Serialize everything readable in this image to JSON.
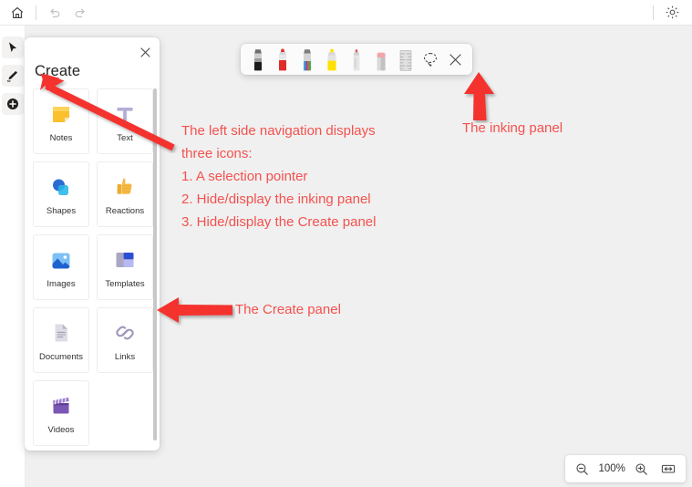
{
  "topbar": {
    "home_icon": "home-icon",
    "undo_icon": "undo-icon",
    "redo_icon": "redo-icon",
    "settings_icon": "gear-icon"
  },
  "leftnav": {
    "items": [
      {
        "name": "selection-pointer",
        "icon": "cursor-arrow-icon",
        "label": "Selection pointer"
      },
      {
        "name": "inking",
        "icon": "pen-icon",
        "label": "Hide/display the inking panel"
      },
      {
        "name": "create",
        "icon": "plus-circle-icon",
        "label": "Hide/display the Create panel"
      }
    ]
  },
  "create_panel": {
    "title": "Create",
    "close_icon": "close-icon",
    "tiles": [
      {
        "label": "Notes",
        "icon": "sticky-note-icon"
      },
      {
        "label": "Text",
        "icon": "text-t-icon"
      },
      {
        "label": "Shapes",
        "icon": "shapes-icon"
      },
      {
        "label": "Reactions",
        "icon": "thumbs-up-icon"
      },
      {
        "label": "Images",
        "icon": "image-icon"
      },
      {
        "label": "Templates",
        "icon": "templates-icon"
      },
      {
        "label": "Documents",
        "icon": "document-icon"
      },
      {
        "label": "Links",
        "icon": "link-chain-icon"
      },
      {
        "label": "Videos",
        "icon": "video-clapperboard-icon"
      }
    ]
  },
  "ink_panel": {
    "tools": [
      {
        "name": "pen-black",
        "icon": "pen-black-icon",
        "color": "#1b1b1b"
      },
      {
        "name": "pen-red",
        "icon": "pen-red-icon",
        "color": "#e02b27"
      },
      {
        "name": "pen-rainbow",
        "icon": "pen-rainbow-icon",
        "color": "#3aa0d9"
      },
      {
        "name": "highlighter-yellow",
        "icon": "highlighter-yellow-icon",
        "color": "#ffe100"
      },
      {
        "name": "pencil",
        "icon": "pencil-icon",
        "color": "#d9d9d9"
      },
      {
        "name": "eraser",
        "icon": "eraser-icon",
        "color": "#f4a3ab"
      },
      {
        "name": "ruler",
        "icon": "ruler-icon",
        "color": "#d2d2d2"
      },
      {
        "name": "lasso-select",
        "icon": "lasso-select-icon",
        "color": "#4a4a4a"
      },
      {
        "name": "close-ink-panel",
        "icon": "close-icon",
        "color": "#4a4a4a"
      }
    ]
  },
  "annotations": {
    "accent_color": "#f4514e",
    "nav_note": "The left side navigation displays\nthree icons:\n1. A selection pointer\n2. Hide/display the inking panel\n3. Hide/display the Create panel",
    "ink_note": "The inking panel",
    "create_note": "The Create panel",
    "arrows": [
      {
        "name": "arrow-to-left-nav",
        "direction": "up-left"
      },
      {
        "name": "arrow-to-ink-panel",
        "direction": "up"
      },
      {
        "name": "arrow-to-create-panel",
        "direction": "left"
      }
    ]
  },
  "zoombar": {
    "zoom_out_icon": "zoom-out-icon",
    "level": "100%",
    "zoom_in_icon": "zoom-in-icon",
    "fit_icon": "fit-to-screen-icon"
  }
}
